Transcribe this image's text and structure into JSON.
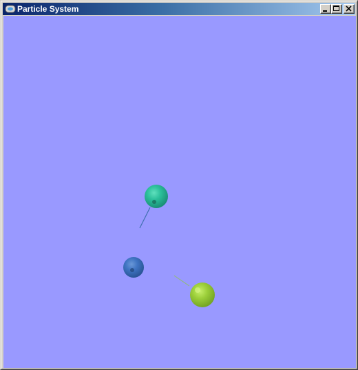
{
  "window": {
    "title": "Particle System"
  },
  "icons": {
    "app": "app-window-icon",
    "minimize": "minimize-icon",
    "maximize": "maximize-icon",
    "close": "close-icon"
  },
  "colors": {
    "titlebar_start": "#0a246a",
    "titlebar_end": "#a6caf0",
    "background": "#9999ff",
    "particle_teal": "#2bbf9a",
    "particle_blue": "#3f74c2",
    "particle_green": "#9ccf3a"
  }
}
